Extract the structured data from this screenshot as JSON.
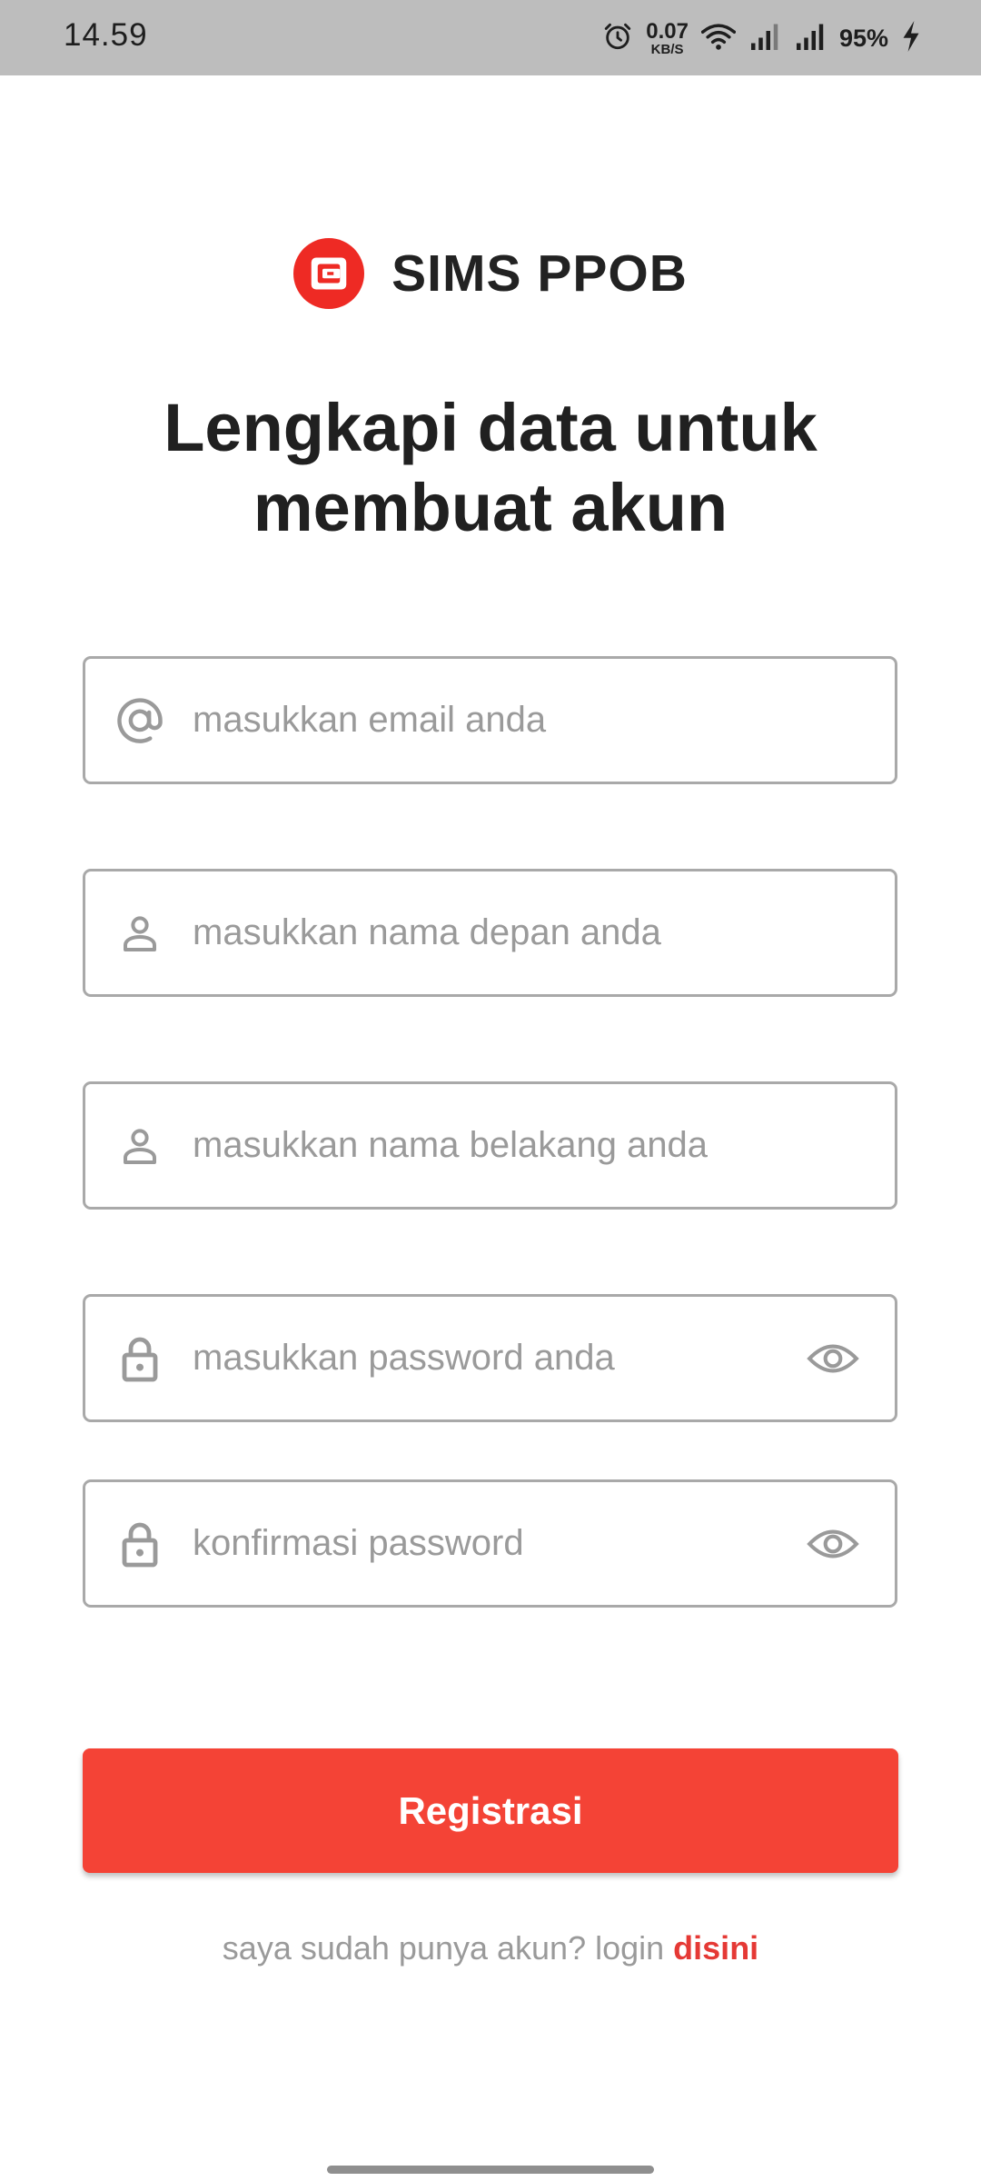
{
  "status_bar": {
    "time": "14.59",
    "net_speed_value": "0.07",
    "net_speed_unit": "KB/S",
    "battery": "95%",
    "icons": [
      "alarm-icon",
      "wifi-icon",
      "signal-icon",
      "signal-icon",
      "charging-icon"
    ]
  },
  "brand": {
    "name": "SIMS PPOB",
    "logo_color": "#ee2a24"
  },
  "title": {
    "line1": "Lengkapi data untuk",
    "line2": "membuat akun"
  },
  "form": {
    "email": {
      "placeholder": "masukkan email anda",
      "icon": "at-icon"
    },
    "first_name": {
      "placeholder": "masukkan nama depan anda",
      "icon": "user-icon"
    },
    "last_name": {
      "placeholder": "masukkan nama belakang anda",
      "icon": "user-icon"
    },
    "password": {
      "placeholder": "masukkan password anda",
      "icon": "lock-icon",
      "toggle_icon": "eye-icon"
    },
    "confirm_password": {
      "placeholder": "konfirmasi password",
      "icon": "lock-icon",
      "toggle_icon": "eye-icon"
    }
  },
  "register_button": {
    "label": "Registrasi",
    "color": "#f44336"
  },
  "login_prompt": {
    "text": "saya sudah punya akun? login ",
    "link": "disini",
    "link_color": "#e53935"
  }
}
